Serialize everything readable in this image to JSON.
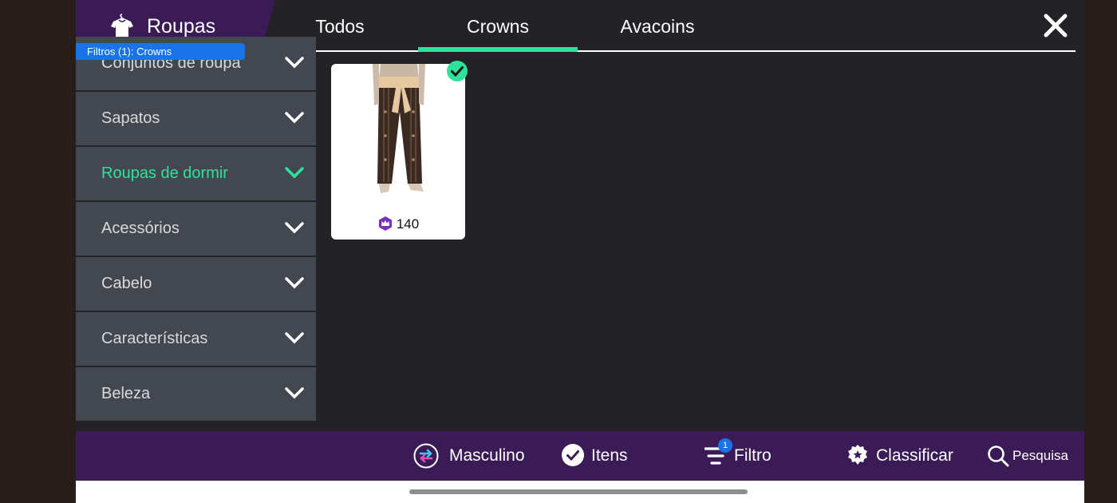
{
  "header": {
    "title": "Roupas",
    "filter_pill": "Filtros (1): Crowns"
  },
  "tabs": [
    {
      "label": "Todos",
      "active": false
    },
    {
      "label": "Crowns",
      "active": true
    },
    {
      "label": "Avacoins",
      "active": false
    }
  ],
  "categories": [
    {
      "label": "Conjuntos de roupa",
      "active": false
    },
    {
      "label": "Sapatos",
      "active": false
    },
    {
      "label": "Roupas de dormir",
      "active": true
    },
    {
      "label": "Acessórios",
      "active": false
    },
    {
      "label": "Cabelo",
      "active": false
    },
    {
      "label": "Características",
      "active": false
    },
    {
      "label": "Beleza",
      "active": false
    }
  ],
  "item": {
    "price": "140",
    "currency_icon": "crown-icon",
    "owned": true
  },
  "bottombar": {
    "gender": "Masculino",
    "items": "Itens",
    "filter": "Filtro",
    "filter_count": "1",
    "sort": "Classificar",
    "search": "Pesquisa"
  },
  "colors": {
    "accent": "#2de39b",
    "header_purple": "#3a1b55",
    "panel_bg": "#232226",
    "category_bg": "#434750",
    "filter_blue": "#1a73e8"
  }
}
